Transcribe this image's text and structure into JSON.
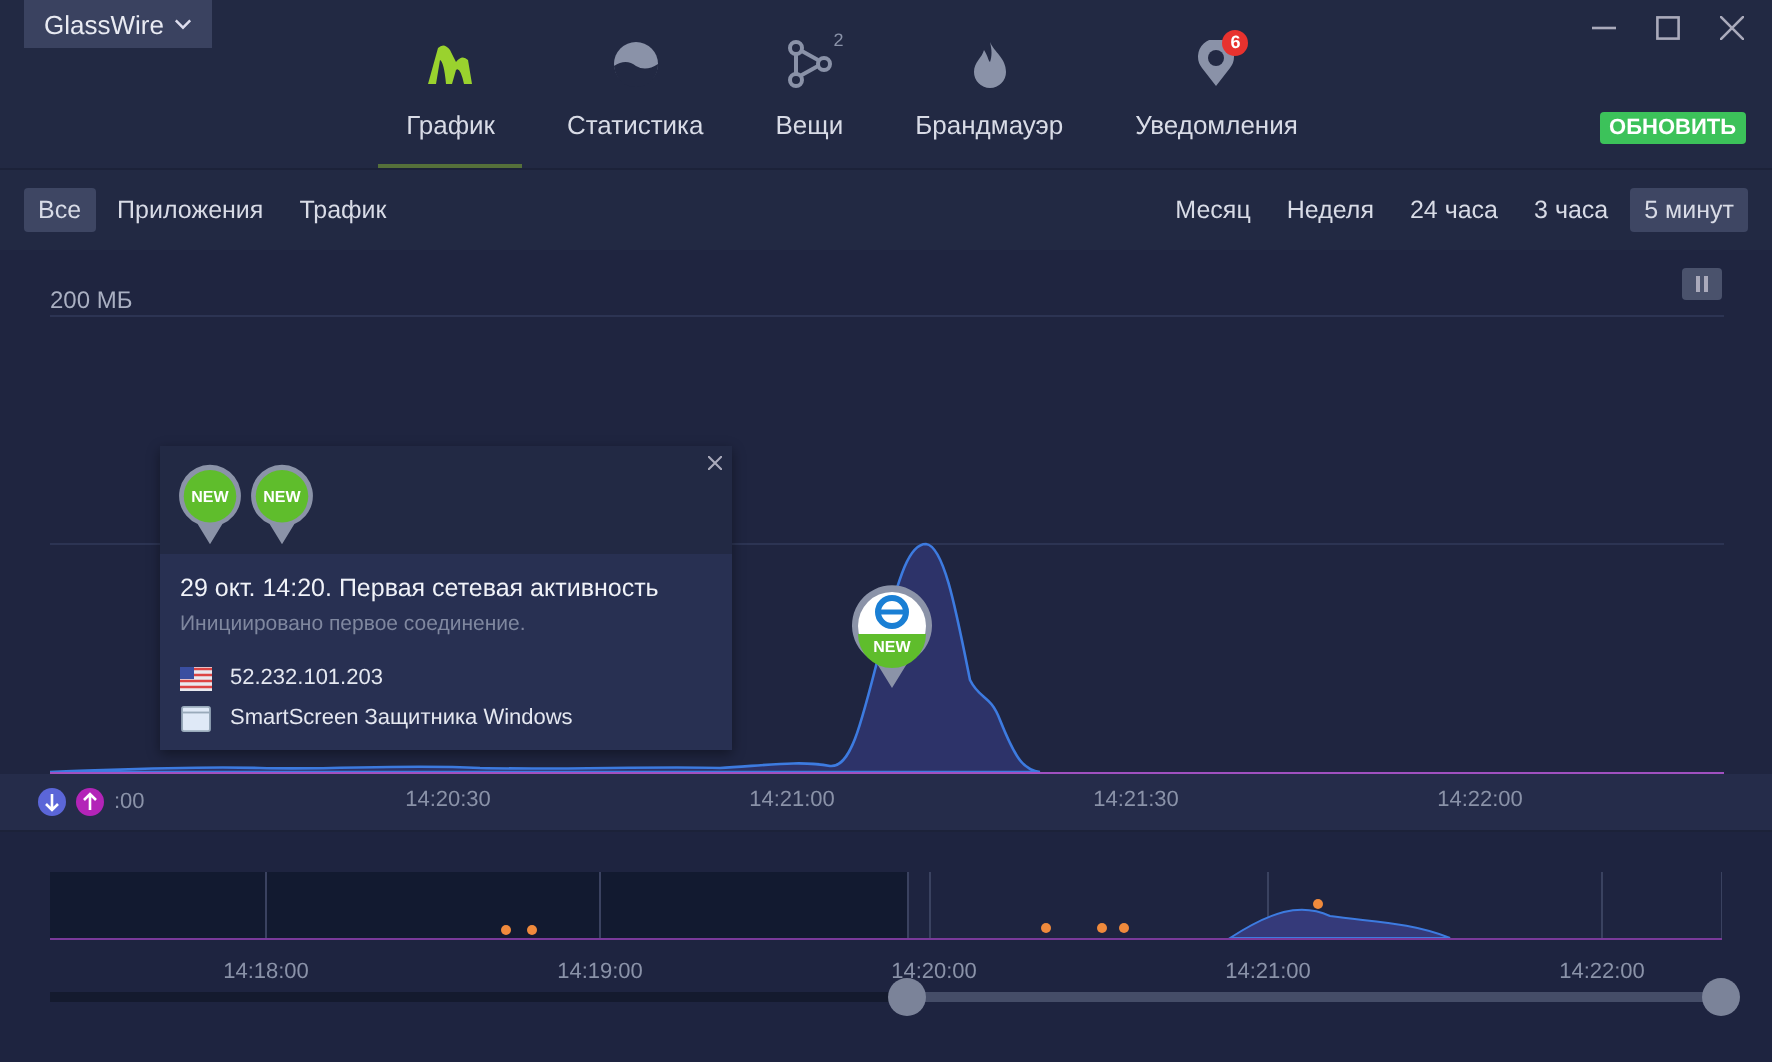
{
  "app_menu": {
    "label": "GlassWire"
  },
  "tabs": [
    {
      "label": "График",
      "kind": "graph",
      "selected": true
    },
    {
      "label": "Статистика",
      "kind": "stats",
      "selected": false
    },
    {
      "label": "Вещи",
      "kind": "things",
      "selected": false,
      "count": "2"
    },
    {
      "label": "Брандмауэр",
      "kind": "firewall",
      "selected": false
    },
    {
      "label": "Уведомления",
      "kind": "alerts",
      "selected": false,
      "badge": "6"
    }
  ],
  "upgrade_button": {
    "label": "ОБНОВИТЬ"
  },
  "filters": [
    {
      "label": "Все",
      "selected": true
    },
    {
      "label": "Приложения",
      "selected": false
    },
    {
      "label": "Трафик",
      "selected": false
    }
  ],
  "ranges": [
    {
      "label": "Месяц",
      "selected": false
    },
    {
      "label": "Неделя",
      "selected": false
    },
    {
      "label": "24 часа",
      "selected": false
    },
    {
      "label": "3 часа",
      "selected": false
    },
    {
      "label": "5 минут",
      "selected": true
    }
  ],
  "graph": {
    "scale_label": "200 МБ",
    "time_labels": [
      ":00",
      "14:20:30",
      "14:21:00",
      "14:21:30",
      "14:22:00"
    ]
  },
  "tooltip": {
    "badges": [
      "NEW",
      "NEW"
    ],
    "title": "29 окт. 14:20. Первая сетевая активность",
    "subtitle": "Инициировано первое соединение.",
    "ip": "52.232.101.203",
    "app": "SmartScreen Защитника Windows"
  },
  "app_pin": {
    "badge": "NEW"
  },
  "overview": {
    "time_labels": [
      "14:18:00",
      "14:19:00",
      "14:20:00",
      "14:21:00",
      "14:22:00"
    ],
    "handles": [
      {
        "level": 0.513
      },
      {
        "level": 1
      }
    ]
  }
}
